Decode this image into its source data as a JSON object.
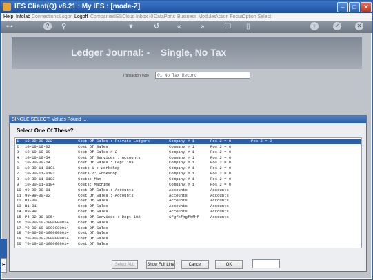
{
  "window": {
    "title": "IES Client(Q) v8.21 : My IES :     [mode-Z]"
  },
  "menubar": [
    "Help",
    "Infolab",
    "Connections",
    "Logon",
    "Logoff",
    "Companies",
    "IESCloud",
    "Inbox (0)",
    "DataPorts",
    "Business Modules",
    "Action Focus",
    "Option Select"
  ],
  "toolbar": {
    "icons": [
      "key-icon",
      "help-icon",
      "search-icon",
      "heart-icon",
      "undo-icon",
      "rewind-icon",
      "forward-icon",
      "copy-icon",
      "bin-icon",
      "add-icon",
      "check-icon",
      "close-icon"
    ]
  },
  "banner": {
    "title": "Ledger Journal: -    Single, No Tax"
  },
  "transaction_type": {
    "label": "Transaction Type",
    "value": "01 No Tax Record"
  },
  "dialog": {
    "title": "SINGLE SELECT: Values Found ...",
    "heading": "Select One Of These?",
    "rows": [
      {
        "n": "1",
        "code": "10-00-00-222",
        "desc": "Cost Of Sales : Private Ledgers",
        "c3": "Company # 1",
        "c4": "Pos 2 = 0",
        "c5": "Pos 3 = 0"
      },
      {
        "n": "2",
        "code": "10-10-10-02",
        "desc": "Cost Of Sales",
        "c3": "Company # 1",
        "c4": "Pos 2 = 0",
        "c5": ""
      },
      {
        "n": "3",
        "code": "10-10-10-09",
        "desc": "Cost Of Sales # 2",
        "c3": "Company # 1",
        "c4": "Pos 2 = 0",
        "c5": ""
      },
      {
        "n": "4",
        "code": "10-10-10-54",
        "desc": "Cost Of Services : Accounts",
        "c3": "Company # 1",
        "c4": "Pos 2 = 0",
        "c5": ""
      },
      {
        "n": "5",
        "code": "10-30-00-14",
        "desc": "Cost Of Sales : Dept 103",
        "c3": "Company # 1",
        "c4": "Pos 2 = 0",
        "c5": ""
      },
      {
        "n": "6",
        "code": "10-30-11-0101",
        "desc": "Costs 1 : Workshop",
        "c3": "Company # 1",
        "c4": "Pos 2 = 0",
        "c5": ""
      },
      {
        "n": "7",
        "code": "10-30-11-0102",
        "desc": "Costs 2: Workshop",
        "c3": "Company # 1",
        "c4": "Pos 2 = 0",
        "c5": ""
      },
      {
        "n": "8",
        "code": "10-30-11-0103",
        "desc": "Costs: Man",
        "c3": "Company # 1",
        "c4": "Pos 2 = 0",
        "c5": ""
      },
      {
        "n": "9",
        "code": "10-30-11-0104",
        "desc": "Costs: Machine",
        "c3": "Company # 1",
        "c4": "Pos 2 = 0",
        "c5": ""
      },
      {
        "n": "10",
        "code": "99-99-00-01",
        "desc": "Cost Of Sales : Accounts",
        "c3": "Accounts",
        "c4": "Accounts",
        "c5": ""
      },
      {
        "n": "11",
        "code": "99-99-00-02",
        "desc": "Cost Of Sales : Accounts",
        "c3": "Accounts",
        "c4": "Accounts",
        "c5": ""
      },
      {
        "n": "12",
        "code": "B1-00",
        "desc": "Cost Of Sales",
        "c3": "Accounts",
        "c4": "Accounts",
        "c5": ""
      },
      {
        "n": "13",
        "code": "B1-01",
        "desc": "Cost Of Sales",
        "c3": "Accounts",
        "c4": "Accounts",
        "c5": ""
      },
      {
        "n": "14",
        "code": "B9-99",
        "desc": "Cost Of Sales",
        "c3": "Accounts",
        "c4": "Accounts",
        "c5": ""
      },
      {
        "n": "15",
        "code": "P4-32-30-1054",
        "desc": "Cost Of Services : Dept 102",
        "c3": "Gfgfhfhgfhfhf",
        "c4": "Accounts",
        "c5": ""
      },
      {
        "n": "16",
        "code": "Y0-00-10-1000000014",
        "desc": "Cost Of Sales",
        "c3": "",
        "c4": "",
        "c5": ""
      },
      {
        "n": "17",
        "code": "Y0-00-10-1000000014",
        "desc": "Cost Of Sales",
        "c3": "",
        "c4": "",
        "c5": ""
      },
      {
        "n": "18",
        "code": "Y0-00-20-1000000014",
        "desc": "Cost Of Sales",
        "c3": "",
        "c4": "",
        "c5": ""
      },
      {
        "n": "19",
        "code": "Y0-00-20-2000000014",
        "desc": "Cost Of Sales",
        "c3": "",
        "c4": "",
        "c5": ""
      },
      {
        "n": "20",
        "code": "Y0-10-10-1000000014",
        "desc": "Cost Of Sales",
        "c3": "",
        "c4": "",
        "c5": ""
      }
    ],
    "buttons": {
      "select_all": "Select ALL",
      "show_full_line": "Show Full Line",
      "cancel": "Cancel",
      "ok": "OK"
    }
  }
}
